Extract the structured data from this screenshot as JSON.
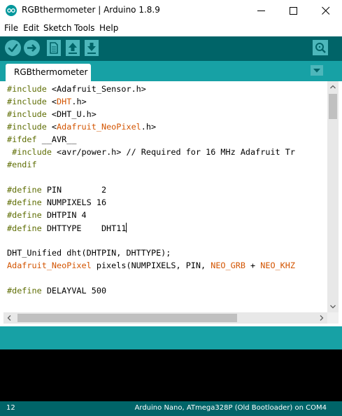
{
  "window": {
    "title": "RGBthermometer | Arduino 1.8.9",
    "controls": [
      "minimize",
      "maximize",
      "close"
    ]
  },
  "menu": {
    "items": [
      "File",
      "Edit",
      "Sketch",
      "Tools",
      "Help"
    ]
  },
  "toolbar": {
    "buttons": [
      "verify-icon",
      "upload-icon",
      "new-icon",
      "open-icon",
      "save-icon"
    ],
    "right_button": "serial-monitor-icon"
  },
  "tabs": {
    "active": "RGBthermometer",
    "menu_icon": "tab-menu-arrow-icon"
  },
  "code": {
    "lines": [
      [
        [
          "pp",
          "#include"
        ],
        [
          "t",
          " <Adafruit_Sensor.h>"
        ]
      ],
      [
        [
          "pp",
          "#include"
        ],
        [
          "t",
          " <"
        ],
        [
          "lib",
          "DHT"
        ],
        [
          "t",
          ".h>"
        ]
      ],
      [
        [
          "pp",
          "#include"
        ],
        [
          "t",
          " <DHT_U.h>"
        ]
      ],
      [
        [
          "pp",
          "#include"
        ],
        [
          "t",
          " <"
        ],
        [
          "lib",
          "Adafruit_NeoPixel"
        ],
        [
          "t",
          ".h>"
        ]
      ],
      [
        [
          "pp",
          "#ifdef"
        ],
        [
          "t",
          " __AVR__"
        ]
      ],
      [
        [
          "t",
          " "
        ],
        [
          "pp",
          "#include"
        ],
        [
          "t",
          " <avr/power.h> // Required for 16 MHz Adafruit Tr"
        ]
      ],
      [
        [
          "pp",
          "#endif"
        ]
      ],
      [],
      [
        [
          "pp",
          "#define"
        ],
        [
          "t",
          " PIN        2"
        ]
      ],
      [
        [
          "pp",
          "#define"
        ],
        [
          "t",
          " NUMPIXELS 16"
        ]
      ],
      [
        [
          "pp",
          "#define"
        ],
        [
          "t",
          " DHTPIN 4"
        ]
      ],
      [
        [
          "pp",
          "#define"
        ],
        [
          "t",
          " DHTTYPE    DHT11"
        ]
      ],
      [],
      [
        [
          "t",
          "DHT_Unified dht(DHTPIN, DHTTYPE);"
        ]
      ],
      [
        [
          "lib",
          "Adafruit_NeoPixel"
        ],
        [
          "t",
          " pixels(NUMPIXELS, PIN, "
        ],
        [
          "lib",
          "NEO_GRB"
        ],
        [
          "t",
          " + "
        ],
        [
          "lib",
          "NEO_KHZ"
        ]
      ],
      [],
      [
        [
          "pp",
          "#define"
        ],
        [
          "t",
          " DELAYVAL 500"
        ]
      ]
    ],
    "caret_line": 11
  },
  "status": {
    "message": "",
    "line_number": "12",
    "board": "Arduino Nano, ATmega328P (Old Bootloader) on COM4"
  },
  "colors": {
    "toolbar_bg": "#006468",
    "tab_bar_bg": "#17a1a5",
    "button_bg": "#4db7bb",
    "keyword": "#5e6d03",
    "library": "#d35400",
    "console_bg": "#000000"
  }
}
